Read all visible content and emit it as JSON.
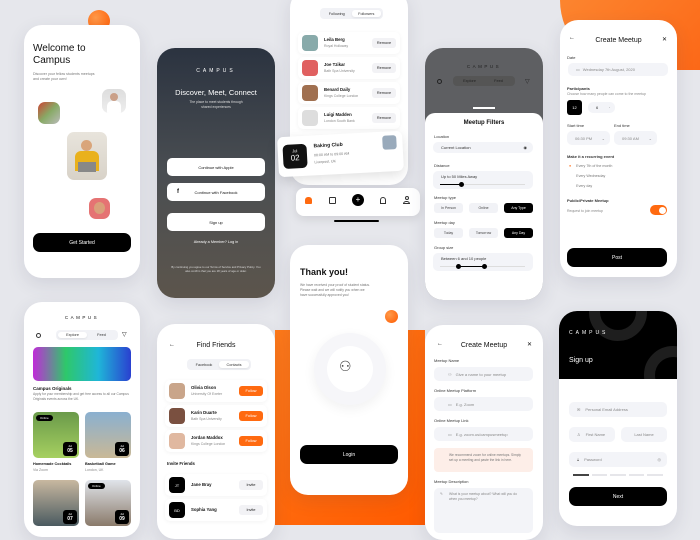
{
  "welcome": {
    "title_line1": "Welcome to",
    "title_line2": "Campus",
    "subtitle_line1": "Discover your fellow students meetups",
    "subtitle_line2": "and create your own!",
    "cta": "Get Started"
  },
  "login": {
    "brand": "CAMPUS",
    "headline": "Discover, Meet, Connect",
    "tagline_line1": "The place to meet students through",
    "tagline_line2": "shared experiences",
    "apple": "Continue with Apple",
    "facebook": "Continue with Facebook",
    "signup": "Sign up",
    "member": "Already a Member? Log in",
    "terms": "By continuing you agree to our Terms of Service and Privacy Policy. You also confirm that you are 18 years of age or older."
  },
  "followers": {
    "tabs": [
      "Following",
      "Followers"
    ],
    "active_tab": "Followers",
    "items": [
      {
        "name": "Leila Berg",
        "school": "Royal Holloway",
        "action": "Remove"
      },
      {
        "name": "Joe Tzikar",
        "school": "Bath Spa University",
        "action": "Remove"
      },
      {
        "name": "Benard Daily",
        "school": "Kings College London",
        "action": "Remove"
      },
      {
        "name": "Luigi Madden",
        "school": "London South Bank",
        "action": "Remove"
      }
    ]
  },
  "event_card": {
    "month": "Jul",
    "day": "02",
    "title": "Baking Club",
    "time": "08:00 AM to 09:00 AM",
    "location": "Liverpool, UK"
  },
  "tabbar": {
    "items": [
      "home",
      "calendar",
      "add",
      "notifications",
      "profile"
    ],
    "active": "home"
  },
  "filters": {
    "brand": "CAMPUS",
    "tabs": [
      "Explore",
      "Feed"
    ],
    "title": "Meetup Filters",
    "location_label": "Location",
    "location_value": "Current Location",
    "distance_label": "Distance",
    "distance_value": "Up to 50 Miles Away",
    "distance_fraction": 0.25,
    "type_label": "Meetup type",
    "types": [
      "In Person",
      "Online",
      "Any Type"
    ],
    "type_selected": "Any Type",
    "day_label": "Meetup day",
    "days": [
      "Today",
      "Tomorrow",
      "Any Day"
    ],
    "day_selected": "Any Day",
    "group_label": "Group size",
    "group_value": "Between 6 and 10 people",
    "group_min_fraction": 0.22,
    "group_max_fraction": 0.52
  },
  "create1": {
    "title": "Create Meetup",
    "date_label": "Date",
    "date_value": "Wednesday 7th August, 2020",
    "participants_label": "Participants",
    "participants_hint": "Choose how many people can come to the meetup",
    "participants_count": "12",
    "participants_step": "6",
    "start_label": "Start time",
    "start_value": "06:30 PM",
    "end_label": "End time",
    "end_value": "09:30 AM",
    "recurring_label": "Make it a recurring event",
    "recurring_options": [
      "Every 7th of the month",
      "Every Wednesday",
      "Every day"
    ],
    "recurring_selected": "Every 7th of the month",
    "privacy_label": "Public/Private Meetup",
    "privacy_text": "Request to join meetup",
    "privacy_on": true,
    "post": "Post"
  },
  "explore": {
    "brand": "CAMPUS",
    "tabs": [
      "Explore",
      "Feed"
    ],
    "feature_title": "Campus Originals",
    "feature_text": "Apply for your membership and get free access to all our Campus Originals events across the UK.",
    "cards": [
      {
        "badge": "Online",
        "month": "Jul",
        "day": "05",
        "title": "Homemade Cocktails",
        "place": "Via Zoom"
      },
      {
        "badge": "",
        "month": "Jul",
        "day": "06",
        "title": "Basketball Game",
        "place": "London, UK"
      },
      {
        "badge": "",
        "month": "Jul",
        "day": "07",
        "title": "",
        "place": ""
      },
      {
        "badge": "Online",
        "month": "Jul",
        "day": "09",
        "title": "",
        "place": ""
      }
    ]
  },
  "friends": {
    "title": "Find Friends",
    "tabs": [
      "Facebook",
      "Contacts"
    ],
    "active_tab": "Contacts",
    "suggested": [
      {
        "name": "Olivia Olson",
        "school": "University Of Exeter",
        "action": "Follow"
      },
      {
        "name": "Karin Duarte",
        "school": "Bath Spa University",
        "action": "Follow"
      },
      {
        "name": "Jordan Maddox",
        "school": "Kings College London",
        "action": "Follow"
      }
    ],
    "invite_label": "Invite Friends",
    "invites": [
      {
        "initials": "JT",
        "name": "Jane Bray",
        "action": "Invite"
      },
      {
        "initials": "BD",
        "name": "Sophia Yang",
        "action": "Invite"
      }
    ]
  },
  "thanks": {
    "title": "Thank you!",
    "line1": "We have received your proof of student status.",
    "line2": "Please wait and we will notify you when we",
    "line3": "have successfully approved you!",
    "cta": "Login"
  },
  "create2": {
    "title": "Create Meetup",
    "name_label": "Meetup Name",
    "name_placeholder": "Give a name to your meetup",
    "platform_label": "Online Meetup Platform",
    "platform_placeholder": "E.g. Zoom",
    "link_label": "Online Meetup Link",
    "link_placeholder": "E.g. zoom.us/campusmeetup",
    "notice": "We recommend zoom for online meetups. Simply set up a meeting and paste the link in here.",
    "desc_label": "Meetup Description",
    "desc_placeholder": "What is your meetup about? What will you do when you meetup?"
  },
  "signup": {
    "brand": "CAMPUS",
    "title": "Sign up",
    "email_placeholder": "Personal Email Address",
    "first_placeholder": "First Name",
    "last_placeholder": "Last Name",
    "password_placeholder": "Password",
    "strength_fraction": 0.2,
    "cta": "Next"
  },
  "colors": {
    "accent": "#ff6a10",
    "dark": "#000000",
    "field": "#f3f4f8"
  }
}
